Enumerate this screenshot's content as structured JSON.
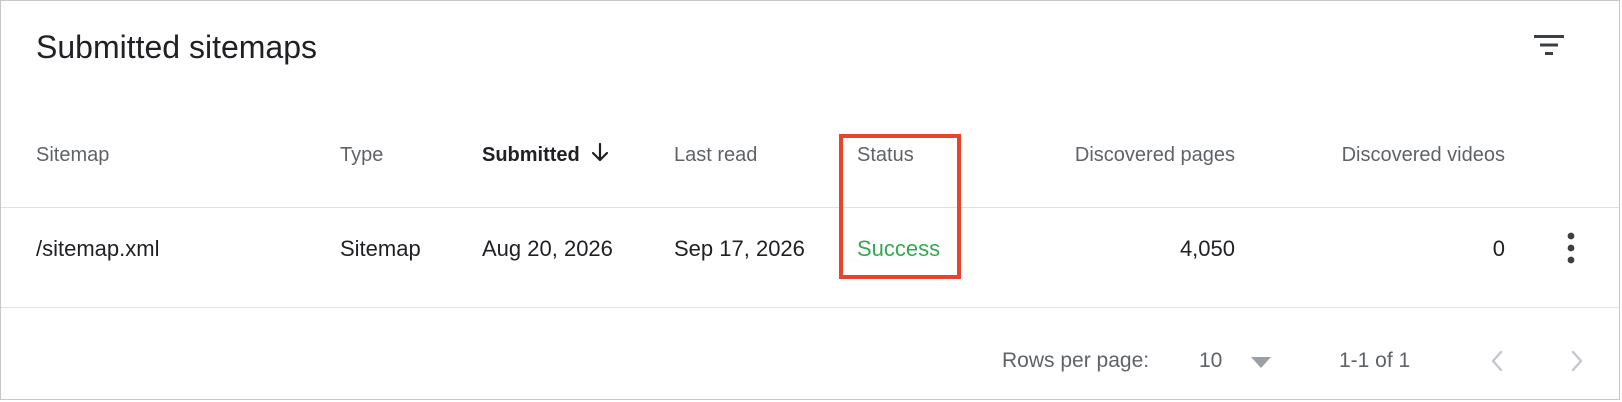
{
  "card": {
    "title": "Submitted sitemaps",
    "filter_icon": "filter-list-icon"
  },
  "table": {
    "columns": [
      {
        "label": "Sitemap"
      },
      {
        "label": "Type"
      },
      {
        "label": "Submitted",
        "sorted": "descending",
        "icon": "arrow-down-icon"
      },
      {
        "label": "Last read"
      },
      {
        "label": "Status"
      },
      {
        "label": "Discovered pages"
      },
      {
        "label": "Discovered videos"
      }
    ],
    "rows": [
      {
        "sitemap": "/sitemap.xml",
        "type": "Sitemap",
        "submitted": "Aug 20, 2026",
        "last_read": "Sep 17, 2026",
        "status": "Success",
        "discovered_pages": "4,050",
        "discovered_videos": "0",
        "row_menu_icon": "more-vert-icon"
      }
    ]
  },
  "pagination": {
    "rows_per_page_label": "Rows per page:",
    "rows_per_page_value": "10",
    "range_text": "1-1 of 1",
    "prev_icon": "chevron-left-icon",
    "next_icon": "chevron-right-icon"
  },
  "colors": {
    "success": "#34a853",
    "highlight": "#e8432d",
    "text_primary": "#202124",
    "text_secondary": "#5f6368",
    "divider": "#e0e0e0"
  }
}
